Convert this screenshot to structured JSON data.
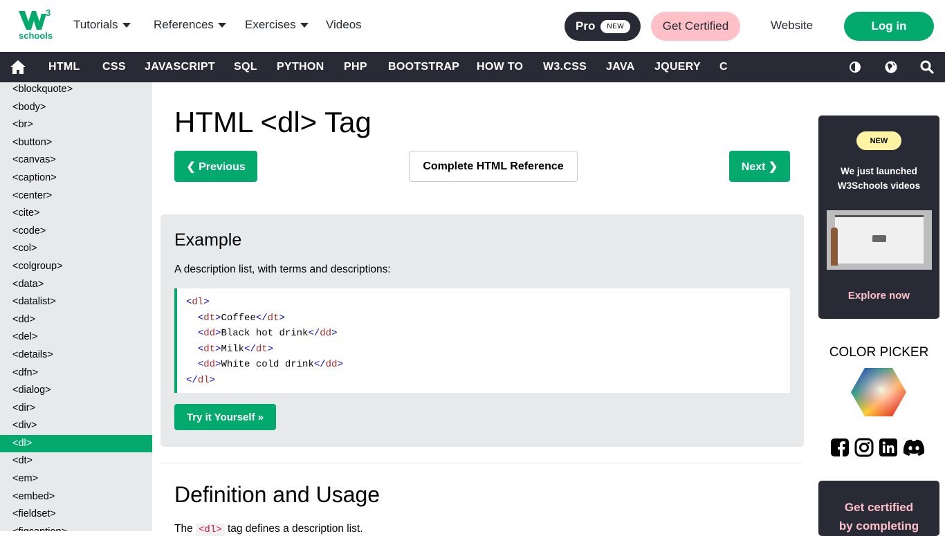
{
  "header": {
    "logo_sup": "3",
    "logo_text": "schools",
    "nav": [
      {
        "label": "Tutorials",
        "has_dropdown": true
      },
      {
        "label": "References",
        "has_dropdown": true
      },
      {
        "label": "Exercises",
        "has_dropdown": true
      },
      {
        "label": "Videos",
        "has_dropdown": false
      }
    ],
    "pro_label": "Pro",
    "pro_badge": "NEW",
    "certified_label": "Get Certified",
    "website_label": "Website",
    "login_label": "Log in"
  },
  "topnav": {
    "home_icon": "home-icon",
    "items": [
      "HTML",
      "CSS",
      "JAVASCRIPT",
      "SQL",
      "PYTHON",
      "PHP",
      "BOOTSTRAP",
      "HOW TO",
      "W3.CSS",
      "JAVA",
      "JQUERY",
      "C"
    ],
    "icons": [
      "contrast-icon",
      "globe-icon",
      "search-icon"
    ]
  },
  "sidebar": {
    "items": [
      "<blockquote>",
      "<body>",
      "<br>",
      "<button>",
      "<canvas>",
      "<caption>",
      "<center>",
      "<cite>",
      "<code>",
      "<col>",
      "<colgroup>",
      "<data>",
      "<datalist>",
      "<dd>",
      "<del>",
      "<details>",
      "<dfn>",
      "<dialog>",
      "<dir>",
      "<div>",
      "<dl>",
      "<dt>",
      "<em>",
      "<embed>",
      "<fieldset>",
      "<figcaption>"
    ],
    "active": "<dl>"
  },
  "main": {
    "title": "HTML <dl> Tag",
    "prev_label": "❮ Previous",
    "ref_label": "Complete HTML Reference",
    "next_label": "Next ❯",
    "example": {
      "heading": "Example",
      "description": "A description list, with terms and descriptions:",
      "code": [
        {
          "indent": 0,
          "open": "dl",
          "text": "",
          "close": ""
        },
        {
          "indent": 1,
          "open": "dt",
          "text": "Coffee",
          "close": "dt"
        },
        {
          "indent": 1,
          "open": "dd",
          "text": "Black hot drink",
          "close": "dd"
        },
        {
          "indent": 1,
          "open": "dt",
          "text": "Milk",
          "close": "dt"
        },
        {
          "indent": 1,
          "open": "dd",
          "text": "White cold drink",
          "close": "dd"
        },
        {
          "indent": 0,
          "open": "",
          "text": "",
          "close": "dl"
        }
      ],
      "try_label": "Try it Yourself »"
    },
    "definition": {
      "heading": "Definition and Usage",
      "text_before": "The",
      "inline_code": "<dl>",
      "text_after": "tag defines a description list."
    }
  },
  "rightcol": {
    "ad": {
      "badge": "NEW",
      "title_line1": "We just launched",
      "title_line2": "W3Schools videos",
      "cta": "Explore now"
    },
    "color_picker_title": "COLOR PICKER",
    "social": [
      "facebook-icon",
      "instagram-icon",
      "linkedin-icon",
      "discord-icon"
    ],
    "ad2": {
      "line1": "Get certified",
      "line2": "by completing"
    }
  },
  "colors": {
    "brand_green": "#04AA6D",
    "dark": "#282A35",
    "pink": "#FFC0C7",
    "yellow": "#FFF4A3",
    "sidebar_bg": "#E7E9EB"
  }
}
